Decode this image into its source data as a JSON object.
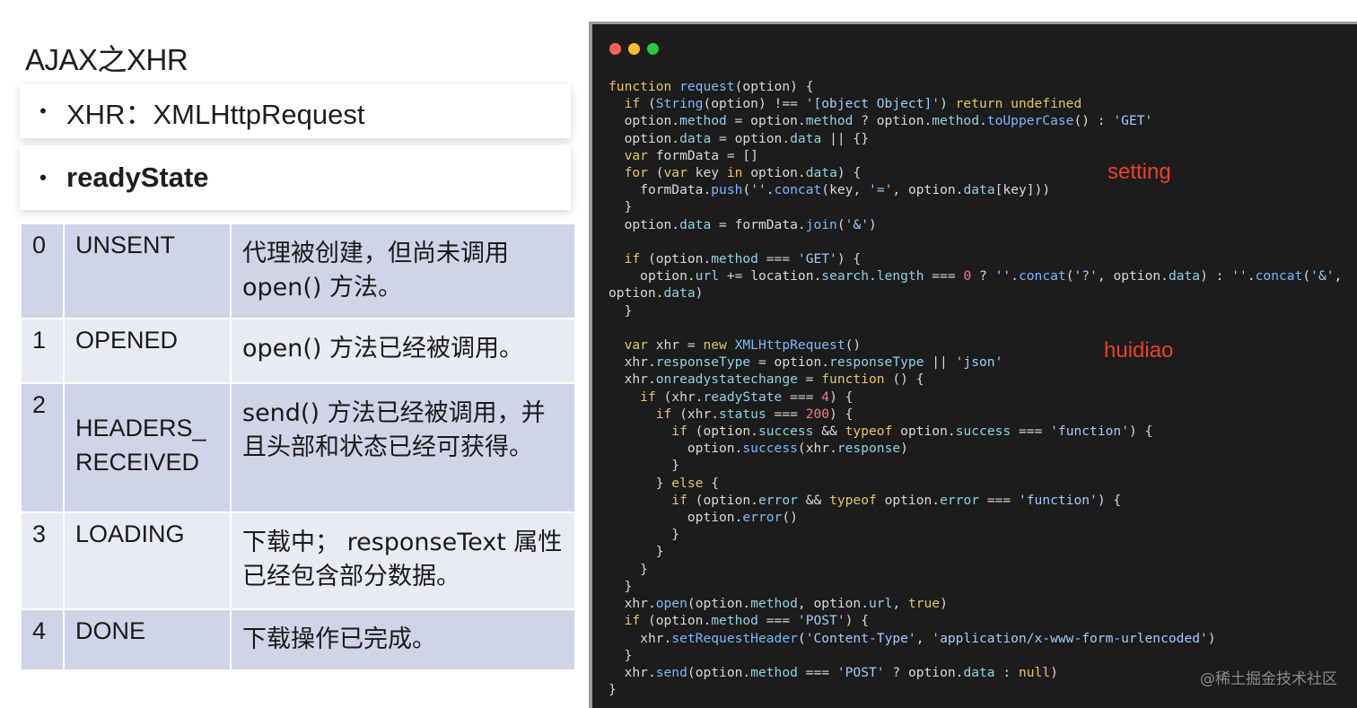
{
  "slide": {
    "title": "AJAX之XHR",
    "bullets": [
      "XHR：XMLHttpRequest",
      "readyState"
    ],
    "bullet_symbol": "•"
  },
  "ready_states": [
    {
      "num": "0",
      "name": "UNSENT",
      "desc": "代理被创建，但尚未调用 open() 方法。"
    },
    {
      "num": "1",
      "name": "OPENED",
      "desc": "open() 方法已经被调用。"
    },
    {
      "num": "2",
      "name": "HEADERS_ RECEIVED",
      "desc": "send() 方法已经被调用，并且头部和状态已经可获得。"
    },
    {
      "num": "3",
      "name": "LOADING",
      "desc": "下载中； responseText 属性已经包含部分数据。"
    },
    {
      "num": "4",
      "name": "DONE",
      "desc": "下载操作已完成。"
    }
  ],
  "code": {
    "lines": [
      "function request(option) {",
      "  if (String(option) !== '[object Object]') return undefined",
      "  option.method = option.method ? option.method.toUpperCase() : 'GET'",
      "  option.data = option.data || {}",
      "  var formData = []",
      "  for (var key in option.data) {",
      "    formData.push(''.concat(key, '=', option.data[key]))",
      "  }",
      "  option.data = formData.join('&')",
      "",
      "  if (option.method === 'GET') {",
      "    option.url += location.search.length === 0 ? ''.concat('?', option.data) : ''.concat('&',",
      "option.data)",
      "  }",
      "",
      "  var xhr = new XMLHttpRequest()",
      "  xhr.responseType = option.responseType || 'json'",
      "  xhr.onreadystatechange = function () {",
      "    if (xhr.readyState === 4) {",
      "      if (xhr.status === 200) {",
      "        if (option.success && typeof option.success === 'function') {",
      "          option.success(xhr.response)",
      "        }",
      "      } else {",
      "        if (option.error && typeof option.error === 'function') {",
      "          option.error()",
      "        }",
      "      }",
      "    }",
      "  }",
      "  xhr.open(option.method, option.url, true)",
      "  if (option.method === 'POST') {",
      "    xhr.setRequestHeader('Content-Type', 'application/x-www-form-urlencoded')",
      "  }",
      "  xhr.send(option.method === 'POST' ? option.data : null)",
      "}"
    ]
  },
  "annotations": {
    "setting": "setting",
    "callback": "huidiao"
  },
  "watermark": "@稀土掘金技术社区",
  "colors": {
    "code_bg": "#1c1c1c",
    "annotation": "#e8412b",
    "table_dark": "#d0d4e8",
    "table_light": "#e8eaf4",
    "traffic_red": "#ff5f56",
    "traffic_yellow": "#ffbd2e",
    "traffic_green": "#27c93f"
  }
}
